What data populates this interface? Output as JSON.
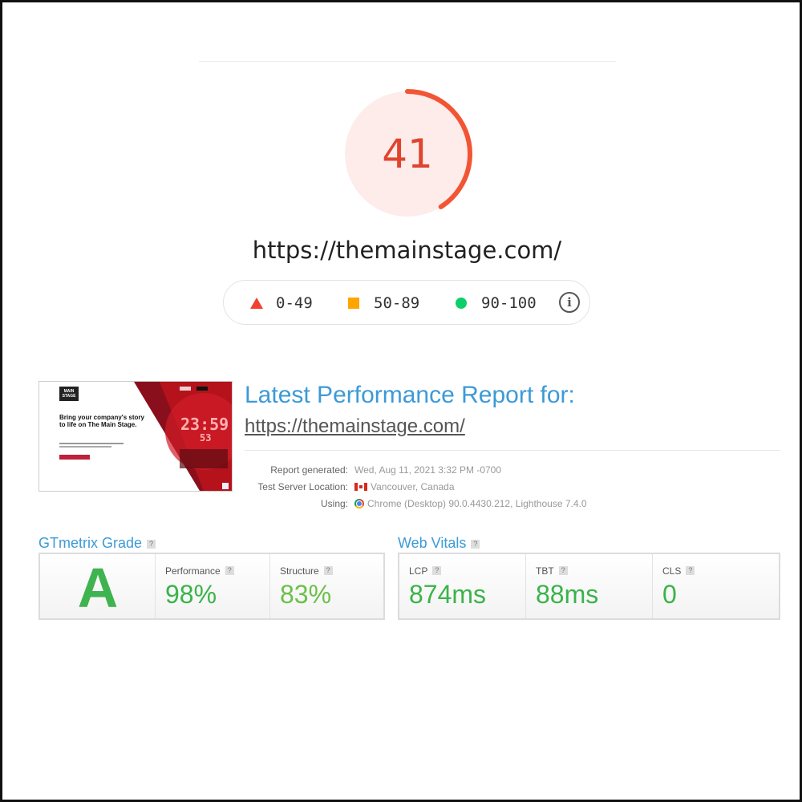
{
  "lighthouse": {
    "score": "41",
    "score_fraction": 0.41,
    "score_color": "#e0442e",
    "url": "https://themainstage.com/",
    "legend": [
      {
        "icon": "red-triangle-icon",
        "range": "0-49",
        "color": "#f0412f"
      },
      {
        "icon": "orange-square-icon",
        "range": "50-89",
        "color": "#ffa400"
      },
      {
        "icon": "green-circle-icon",
        "range": "90-100",
        "color": "#0cce6b"
      }
    ],
    "info_icon": "info-icon"
  },
  "gtmetrix": {
    "thumbnail": {
      "logo_text": "MAIN STAGE",
      "headline": "Bring your company's story to life on The Main Stage.",
      "clock": "23:59",
      "clock_seconds": "53"
    },
    "report_title": "Latest Performance Report for:",
    "report_url": "https://themainstage.com/",
    "meta": [
      {
        "label": "Report generated:",
        "value": "Wed, Aug 11, 2021 3:32 PM -0700"
      },
      {
        "label": "Test Server Location:",
        "value": "Vancouver, Canada",
        "icon": "canada-flag-icon"
      },
      {
        "label": "Using:",
        "value": "Chrome (Desktop) 90.0.4430.212, Lighthouse 7.4.0",
        "icon": "chrome-icon"
      }
    ],
    "grade_section": {
      "title": "GTmetrix Grade",
      "help": "?",
      "grade": "A",
      "metrics": [
        {
          "label": "Performance",
          "help": "?",
          "value": "98%"
        },
        {
          "label": "Structure",
          "help": "?",
          "value": "83%"
        }
      ]
    },
    "vitals_section": {
      "title": "Web Vitals",
      "help": "?",
      "metrics": [
        {
          "label": "LCP",
          "help": "?",
          "value": "874ms"
        },
        {
          "label": "TBT",
          "help": "?",
          "value": "88ms"
        },
        {
          "label": "CLS",
          "help": "?",
          "value": "0"
        }
      ]
    }
  }
}
